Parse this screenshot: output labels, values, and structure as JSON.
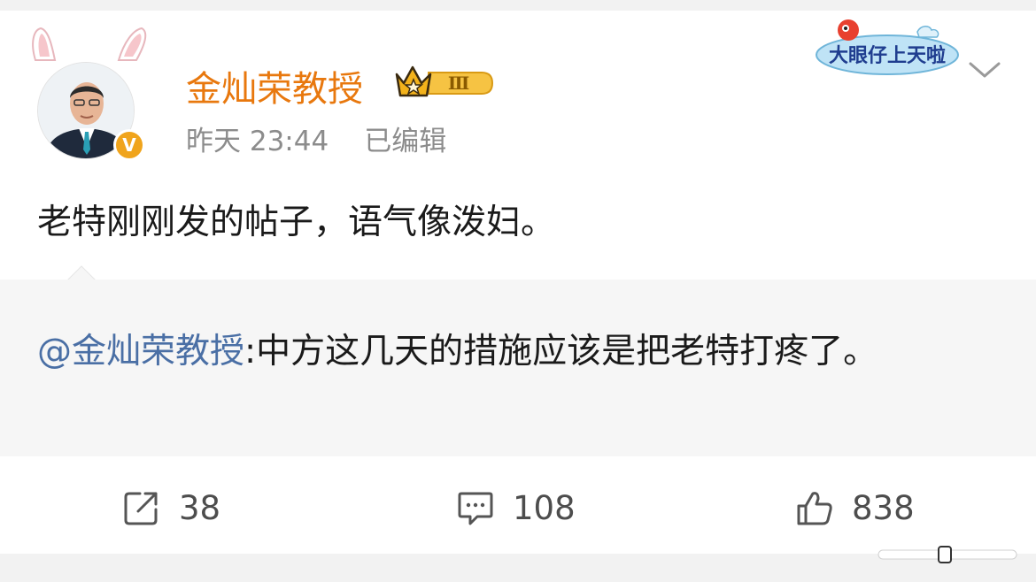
{
  "post": {
    "username": "金灿荣教授",
    "level_badge": "Ⅲ",
    "verified_mark": "V",
    "time": "昨天 23:44",
    "edited": "已编辑",
    "text": "老特刚刚发的帖子，语气像泼妇。"
  },
  "sticker": {
    "text": "大眼仔上天啦"
  },
  "repost": {
    "mention": "@金灿荣教授",
    "text": ":中方这几天的措施应该是把老特打疼了。"
  },
  "actions": {
    "repost_count": "38",
    "comment_count": "108",
    "like_count": "838"
  },
  "icons": [
    "bunny-ears-icon",
    "verified-icon",
    "crown-icon",
    "chevron-down-icon",
    "repost-icon",
    "comment-icon",
    "like-icon"
  ],
  "colors": {
    "username": "#e8780e",
    "mention": "#4a6fa5",
    "verified": "#f0a41c"
  }
}
